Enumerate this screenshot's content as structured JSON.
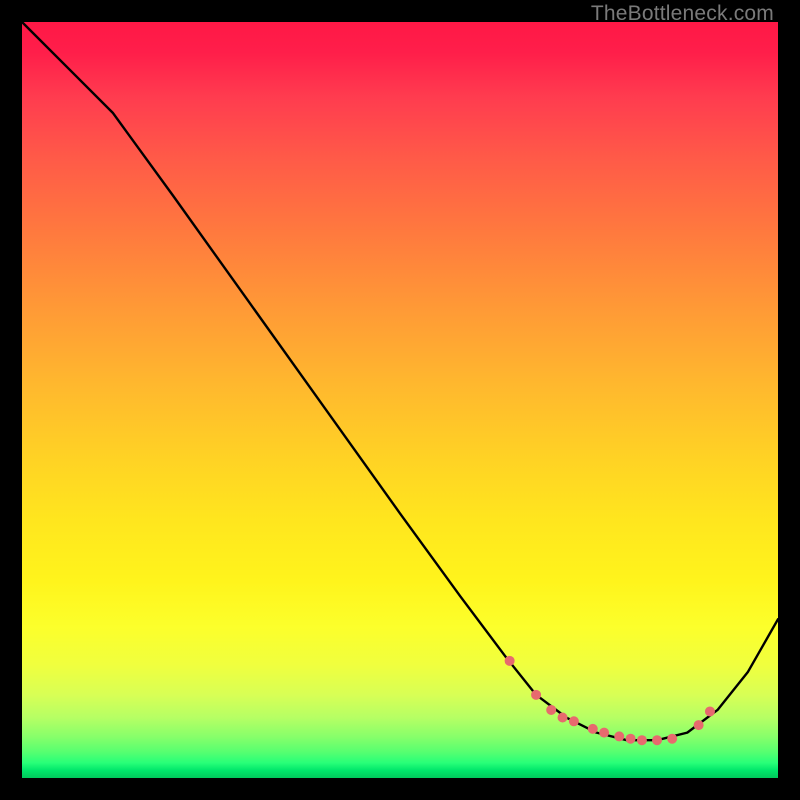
{
  "watermark": "TheBottleneck.com",
  "chart_data": {
    "type": "line",
    "title": "",
    "xlabel": "",
    "ylabel": "",
    "xlim": [
      0,
      100
    ],
    "ylim": [
      0,
      100
    ],
    "series": [
      {
        "name": "curve",
        "x": [
          0,
          7,
          12,
          20,
          30,
          40,
          50,
          58,
          64,
          68,
          72,
          76,
          80,
          84,
          88,
          92,
          96,
          100
        ],
        "y": [
          100,
          93,
          88,
          77,
          63,
          49,
          35,
          24,
          16,
          11,
          8,
          6,
          5,
          5,
          6,
          9,
          14,
          21
        ]
      }
    ],
    "markers": {
      "name": "dots",
      "color": "#e76a6e",
      "x": [
        64.5,
        68.0,
        70.0,
        71.5,
        73.0,
        75.5,
        77.0,
        79.0,
        80.5,
        82.0,
        84.0,
        86.0,
        89.5,
        91.0
      ],
      "y": [
        15.5,
        11.0,
        9.0,
        8.0,
        7.5,
        6.5,
        6.0,
        5.5,
        5.2,
        5.0,
        5.0,
        5.2,
        7.0,
        8.8
      ]
    }
  }
}
